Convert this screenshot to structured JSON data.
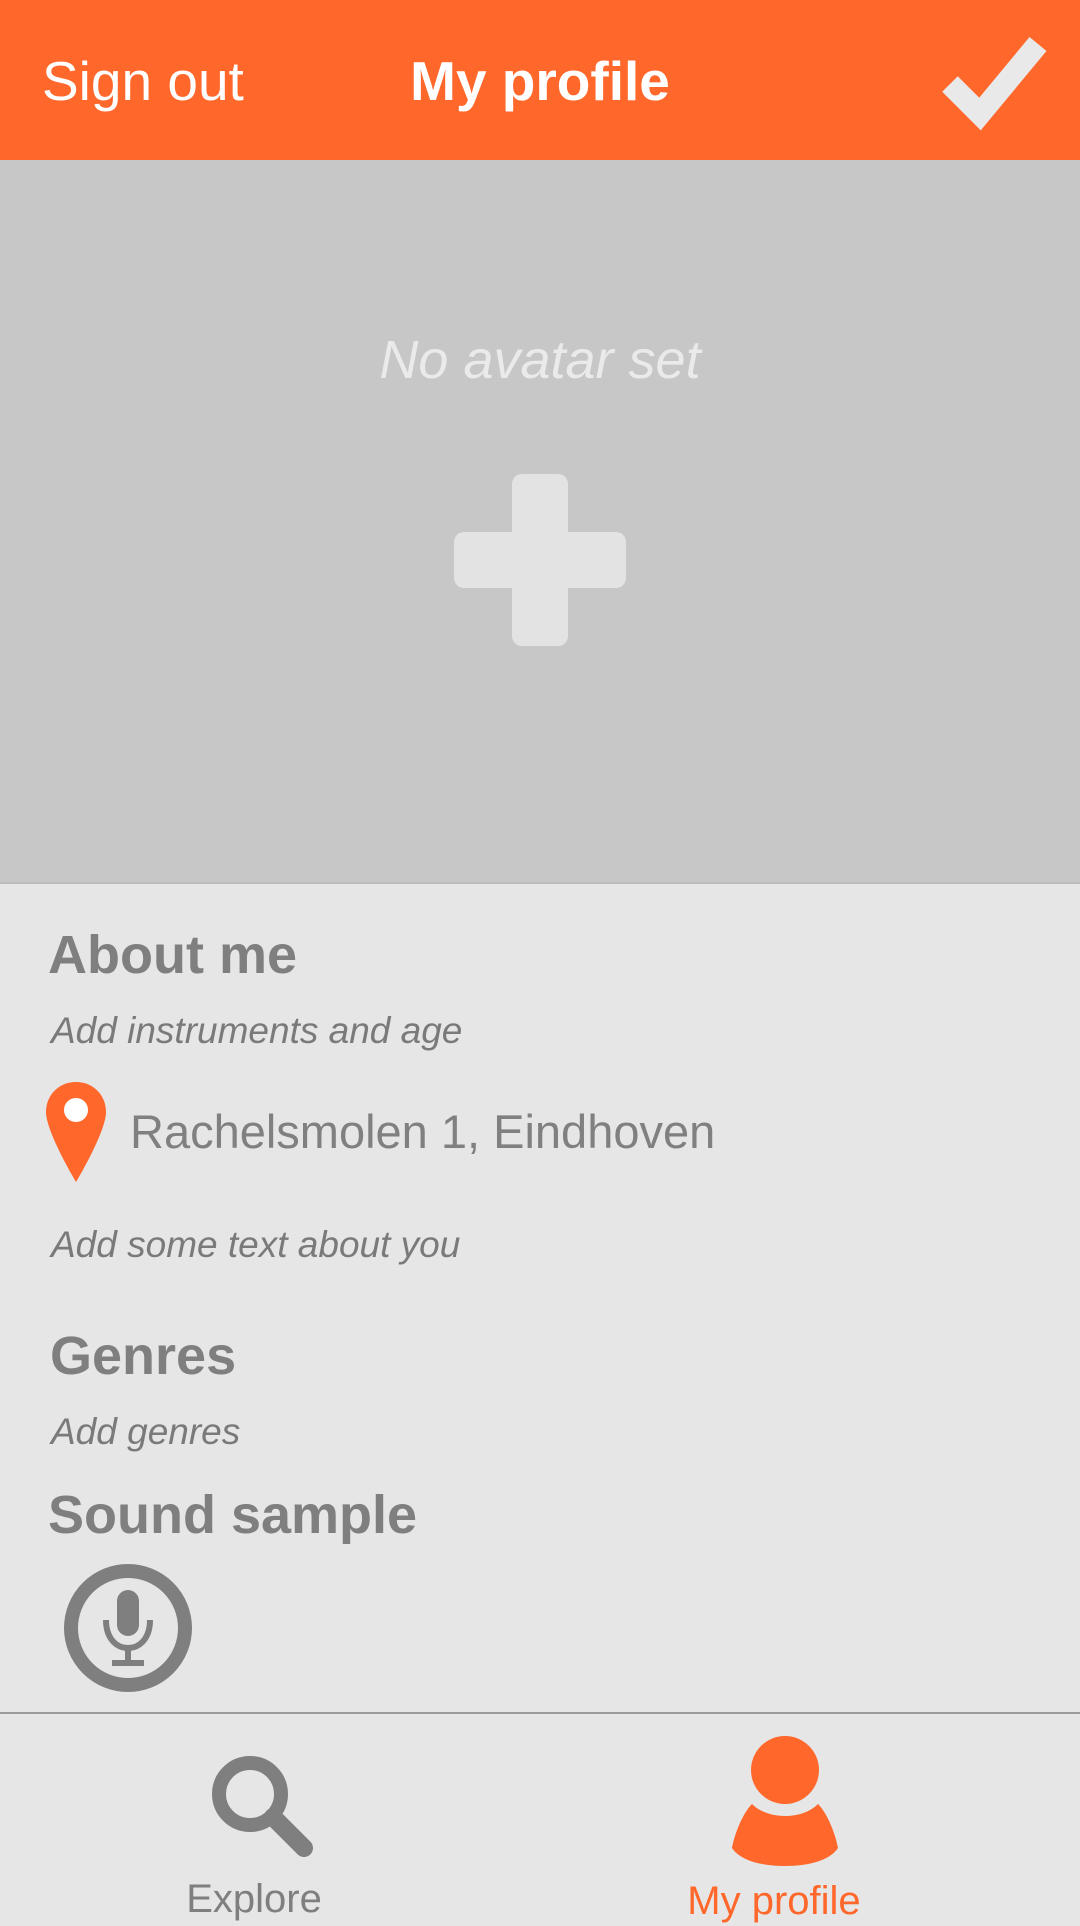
{
  "header": {
    "sign_out": "Sign out",
    "title": "My profile",
    "confirm_icon": "checkmark-icon"
  },
  "avatar": {
    "empty_text": "No avatar set",
    "add_icon": "plus-icon"
  },
  "about": {
    "heading": "About me",
    "instruments_placeholder": "Add instruments and age",
    "location": "Rachelsmolen 1, Eindhoven",
    "location_icon": "map-pin-icon",
    "text_placeholder": "Add some text about you"
  },
  "genres": {
    "heading": "Genres",
    "placeholder": "Add genres"
  },
  "sound": {
    "heading": "Sound sample",
    "record_icon": "microphone-icon"
  },
  "nav": {
    "explore": "Explore",
    "profile": "My profile"
  },
  "colors": {
    "accent": "#ff672b",
    "text_gray": "#808080",
    "avatar_bg": "#c8c7c8",
    "page_bg": "#e6e6e7"
  }
}
